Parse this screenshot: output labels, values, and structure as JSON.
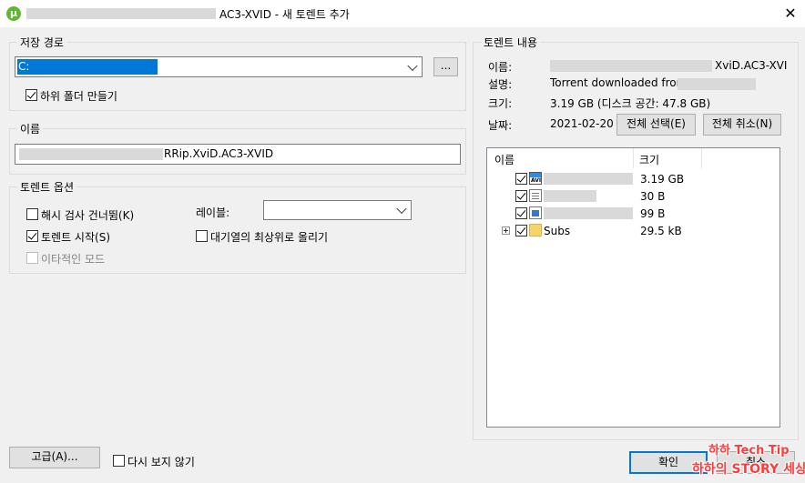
{
  "window": {
    "title_suffix": "AC3-XVID - 새 토렌트 추가",
    "close_glyph": "✕",
    "app_icon": "utorrent-logo-icon"
  },
  "save_path": {
    "legend": "저장 경로",
    "path_value": "C:",
    "browse_label": "...",
    "subfolder_label": "하위 폴더 만들기",
    "subfolder_checked": true
  },
  "name_group": {
    "legend": "이름",
    "name_value": "RRip.XviD.AC3-XVID"
  },
  "torrent_options": {
    "legend": "토렌트 옵션",
    "skip_hash_label": "해시 검사 건너뜀(K)",
    "skip_hash_checked": false,
    "start_label": "토렌트 시작(S)",
    "start_checked": true,
    "sequential_label": "이타적인 모드",
    "sequential_checked": false,
    "label_label": "레이블:",
    "label_value": "",
    "queue_top_label": "대기열의 최상위로 올리기",
    "queue_top_checked": false
  },
  "content": {
    "legend": "토렌트 내용",
    "name_label": "이름:",
    "name_value": "XviD.AC3-XVI",
    "desc_label": "설명:",
    "desc_value": "Torrent downloaded from",
    "size_label": "크기:",
    "size_value": "3.19 GB (디스크 공간: 47.8 GB)",
    "date_label": "날짜:",
    "date_value": "2021-02-20",
    "select_all_label": "전체 선택(E)",
    "select_none_label": "전체 취소(N)",
    "columns": {
      "name": "이름",
      "size": "크기"
    },
    "files": [
      {
        "name": "",
        "size": "3.19 GB",
        "icon": "avi-file-icon",
        "checked": true
      },
      {
        "name": "",
        "size": "30 B",
        "icon": "text-file-icon",
        "checked": true
      },
      {
        "name": "",
        "size": "99 B",
        "icon": "image-file-icon",
        "checked": true
      },
      {
        "name": "Subs",
        "size": "29.5 kB",
        "icon": "folder-icon",
        "checked": true
      }
    ]
  },
  "footer": {
    "advanced_label": "고급(A)...",
    "dont_show_label": "다시 보지 않기",
    "dont_show_checked": false,
    "ok_label": "확인",
    "cancel_label": "취소"
  },
  "watermark": {
    "line1": "하하 Tech Tip",
    "line2": "하하의 STORY 세상"
  }
}
